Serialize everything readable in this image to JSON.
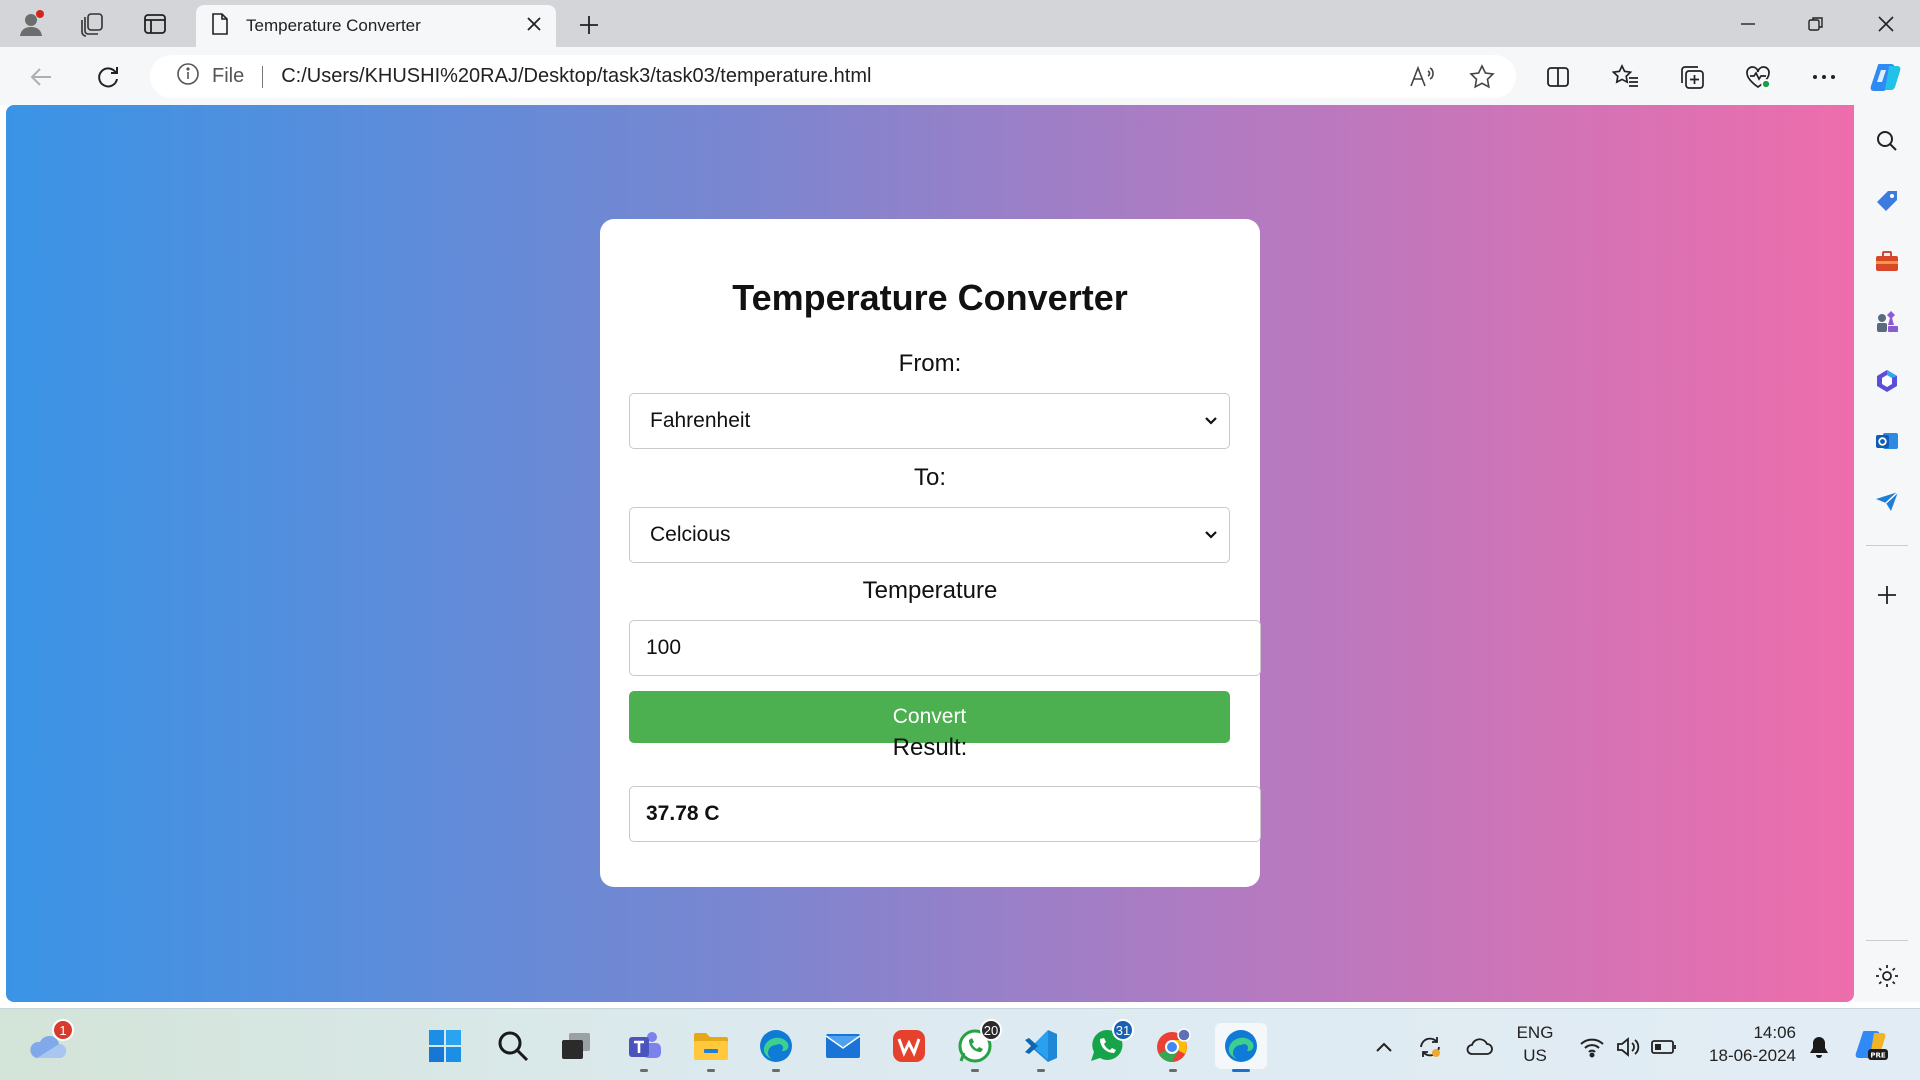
{
  "tab": {
    "title": "Temperature Converter"
  },
  "address_bar": {
    "scheme_label": "File",
    "url": "C:/Users/KHUSHI%20RAJ/Desktop/task3/task03/temperature.html"
  },
  "page": {
    "title": "Temperature Converter",
    "from_label": "From:",
    "from_value": "Fahrenheit",
    "to_label": "To:",
    "to_value": "Celcious",
    "temperature_label": "Temperature",
    "temperature_value": "100",
    "convert_label": "Convert",
    "result_label": "Result:",
    "result_value": "37.78 C"
  },
  "taskbar": {
    "weather_badge": "1",
    "whatsapp_badge": "20",
    "whatsapp_beta_badge": "31",
    "language": "ENG",
    "region": "US",
    "time": "14:06",
    "date": "18-06-2024"
  },
  "colors": {
    "gradient_left": "#3a94e6",
    "gradient_right": "#ee6dac",
    "convert_button": "#4caf50"
  },
  "icons": {
    "tab_bar": [
      "profile-icon",
      "workspaces-icon",
      "vertical-tabs-icon",
      "page-icon",
      "close-icon",
      "new-tab-icon"
    ],
    "window": [
      "minimize-icon",
      "restore-icon",
      "window-close-icon"
    ],
    "toolbar": [
      "back-icon",
      "refresh-icon",
      "info-icon",
      "read-aloud-icon",
      "favorite-star-icon",
      "split-screen-icon",
      "favorites-icon",
      "collections-icon",
      "browser-essentials-icon",
      "more-icon",
      "copilot-icon"
    ],
    "sidebar": [
      "search-icon",
      "shopping-icon",
      "tools-icon",
      "games-icon",
      "microsoft365-icon",
      "outlook-icon",
      "send-icon",
      "add-icon",
      "settings-icon"
    ],
    "taskbar": [
      "weather-icon",
      "start-icon",
      "search-icon",
      "task-view-icon",
      "teams-icon",
      "file-explorer-icon",
      "edge-icon",
      "mail-icon",
      "wps-icon",
      "whatsapp-icon",
      "vscode-icon",
      "whatsapp-beta-icon",
      "chrome-icon",
      "edge-active-icon",
      "chevron-up-icon",
      "sync-icon",
      "onedrive-icon",
      "wifi-icon",
      "volume-icon",
      "battery-icon",
      "bell-icon",
      "copilot-pre-icon"
    ]
  }
}
